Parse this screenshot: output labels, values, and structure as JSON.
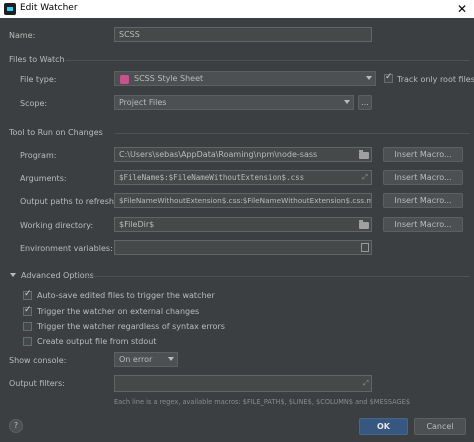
{
  "window": {
    "title": "Edit Watcher",
    "close_glyph": "✕"
  },
  "name": {
    "label": "Name:",
    "value": "SCSS"
  },
  "files_section": {
    "title": "Files to Watch"
  },
  "file_type": {
    "label": "File type:",
    "value": "SCSS Style Sheet",
    "icon": "scss-file-icon",
    "track_only_root": "Track only root files",
    "track_checked": true
  },
  "scope": {
    "label": "Scope:",
    "value": "Project Files",
    "browse": "..."
  },
  "tool_section": {
    "title": "Tool to Run on Changes"
  },
  "program": {
    "label": "Program:",
    "value": "C:\\Users\\sebas\\AppData\\Roaming\\npm\\node-sass",
    "insert_macro": "Insert Macro..."
  },
  "arguments": {
    "label": "Arguments:",
    "value": "$FileName$:$FileNameWithoutExtension$.css",
    "insert_macro": "Insert Macro..."
  },
  "output_paths": {
    "label": "Output paths to refresh:",
    "value": "$FileNameWithoutExtension$.css:$FileNameWithoutExtension$.css.map",
    "insert_macro": "Insert Macro..."
  },
  "working_dir": {
    "label": "Working directory:",
    "value": "$FileDir$",
    "insert_macro": "Insert Macro..."
  },
  "env_vars": {
    "label": "Environment variables:",
    "value": ""
  },
  "advanced": {
    "title": "Advanced Options",
    "options": [
      {
        "label": "Auto-save edited files to trigger the watcher",
        "checked": true
      },
      {
        "label": "Trigger the watcher on external changes",
        "checked": true
      },
      {
        "label": "Trigger the watcher regardless of syntax errors",
        "checked": false
      },
      {
        "label": "Create output file from stdout",
        "checked": false
      }
    ],
    "show_console_label": "Show console:",
    "show_console_value": "On error",
    "output_filters_label": "Output filters:",
    "output_filters_value": "",
    "hint": "Each line is a regex, available macros: $FILE_PATH$, $LINE$, $COLUMN$ and $MESSAGE$"
  },
  "footer": {
    "help": "?",
    "ok": "OK",
    "cancel": "Cancel"
  },
  "colors": {
    "background": "#3c3f41",
    "field": "#45494a",
    "ok_button": "#365880",
    "text": "#bbbbbb"
  }
}
